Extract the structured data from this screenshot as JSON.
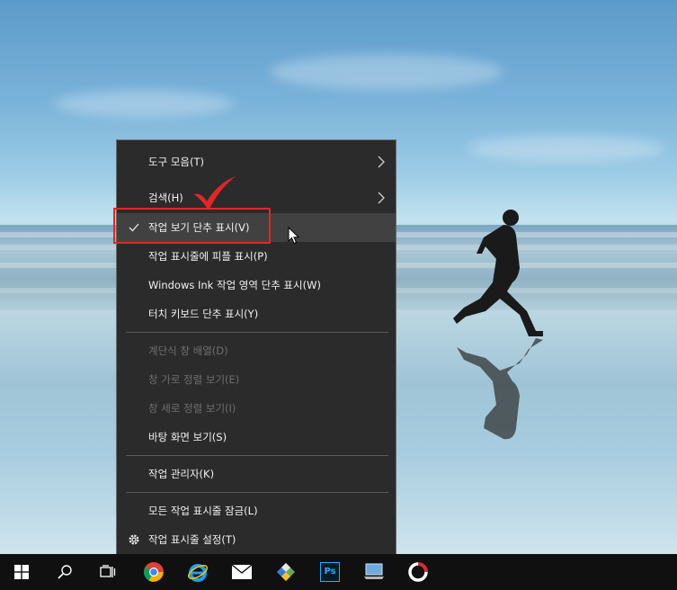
{
  "menu": {
    "items": [
      {
        "label": "도구 모음(T)",
        "submenu": true,
        "enabled": true
      },
      {
        "label": "검색(H)",
        "submenu": true,
        "enabled": true
      },
      {
        "label": "작업 보기 단추 표시(V)",
        "checked": true,
        "enabled": true,
        "highlighted": true
      },
      {
        "label": "작업 표시줄에 피플 표시(P)",
        "enabled": true
      },
      {
        "label": "Windows Ink 작업 영역 단추 표시(W)",
        "enabled": true
      },
      {
        "label": "터치 키보드 단추 표시(Y)",
        "enabled": true
      },
      {
        "label": "계단식 창 배열(D)",
        "enabled": false
      },
      {
        "label": "창 가로 정렬 보기(E)",
        "enabled": false
      },
      {
        "label": "창 세로 정렬 보기(I)",
        "enabled": false
      },
      {
        "label": "바탕 화면 보기(S)",
        "enabled": true
      },
      {
        "label": "작업 관리자(K)",
        "enabled": true
      },
      {
        "label": "모든 작업 표시줄 잠금(L)",
        "enabled": true
      },
      {
        "label": "작업 표시줄 설정(T)",
        "enabled": true,
        "icon": "gear-icon"
      }
    ]
  },
  "annotation": {
    "highlight_color": "#e0272a"
  },
  "taskbar": {
    "icons": [
      "windows-start-icon",
      "search-icon",
      "task-view-icon",
      "chrome-icon",
      "internet-explorer-icon",
      "mail-icon",
      "store-icon",
      "photoshop-icon",
      "network-icon",
      "app-icon"
    ],
    "photoshop_label": "Ps"
  }
}
